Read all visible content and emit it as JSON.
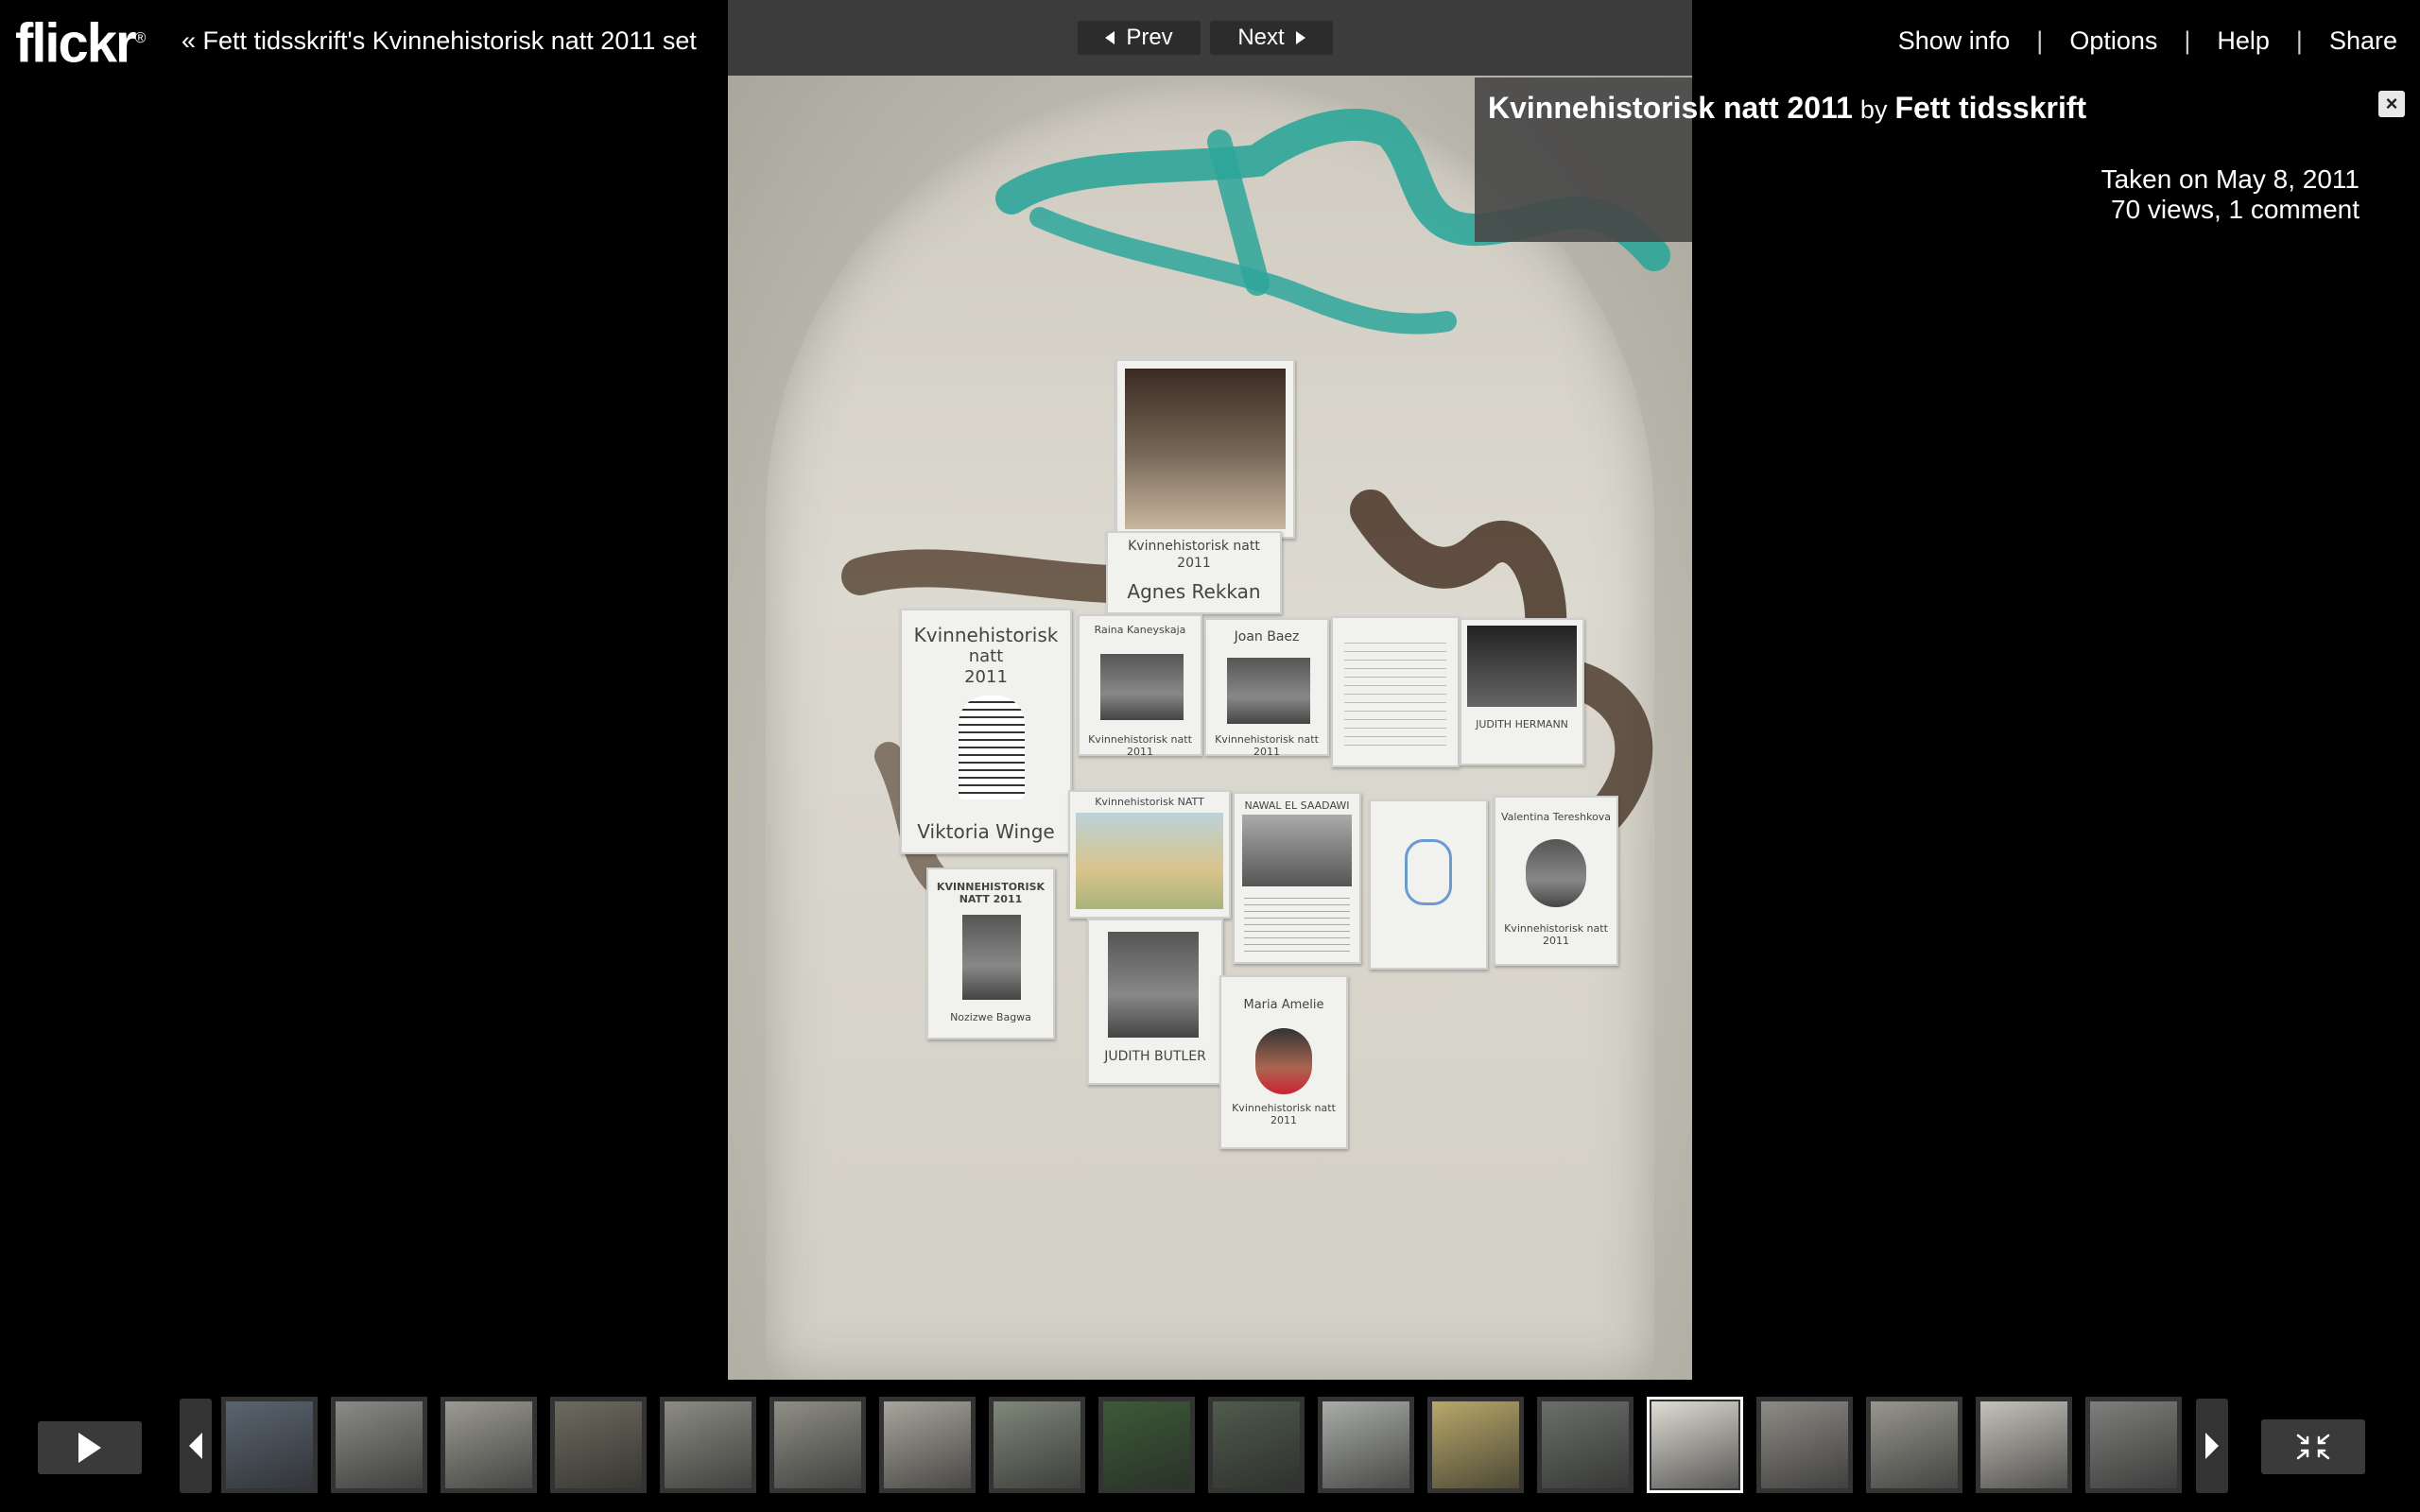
{
  "header": {
    "logo_text": "flickr",
    "logo_mark": "®",
    "set_link": "« Fett tidsskrift's Kvinnehistorisk natt 2011 set"
  },
  "nav": {
    "prev_label": "Prev",
    "next_label": "Next"
  },
  "menu": {
    "items": [
      "Show info",
      "Options",
      "Help",
      "Share"
    ],
    "separator": "|"
  },
  "photo": {
    "title": "Kvinnehistorisk natt 2011",
    "by_label": "by",
    "owner": "Fett tidsskrift",
    "taken": "Taken on May 8, 2011",
    "stats": "70 views, 1 comment",
    "close_label": "×",
    "poster_texts": {
      "p1_line1": "Kvinnehistorisk natt",
      "p1_line2": "2011",
      "p1_line3": "Agnes Rekkan",
      "p2_line1": "Kvinnehistorisk",
      "p2_line2": "natt",
      "p2_line3": "2011",
      "p2_line4": "Viktoria Winge",
      "p3_top": "Raina Kaneyskaja",
      "p3_bottom": "Kvinnehistorisk natt 2011",
      "p4_top": "Joan Baez",
      "p4_bottom": "Kvinnehistorisk natt 2011",
      "p6_bottom": "JUDITH HERMANN",
      "p7_top": "Kvinnehistorisk NATT",
      "p8_top": "NAWAL EL SAADAWI",
      "p10_top": "Valentina Tereshkova",
      "p10_bottom": "Kvinnehistorisk natt 2011",
      "p11_top": "KVINNEHISTORISK NATT 2011",
      "p11_bottom": "Nozizwe Bagwa",
      "p12_bottom": "JUDITH BUTLER",
      "p13_top": "Maria Amelie",
      "p13_bottom": "Kvinnehistorisk natt 2011"
    }
  },
  "filmstrip": {
    "thumb_count": 18,
    "selected_index": 13,
    "thumb_tones": [
      "#5a6470",
      "#8a8a86",
      "#9b9a92",
      "#6e6a5e",
      "#8c8c84",
      "#8f8e86",
      "#a8a59c",
      "#7f877a",
      "#3d5a38",
      "#4f5a4c",
      "#a9aca7",
      "#b8a86a",
      "#6b6f6a",
      "#dedcd4",
      "#8d8b85",
      "#97968e",
      "#c4c2ba",
      "#7e7f7c"
    ],
    "accent_selected": "#ffffff"
  }
}
